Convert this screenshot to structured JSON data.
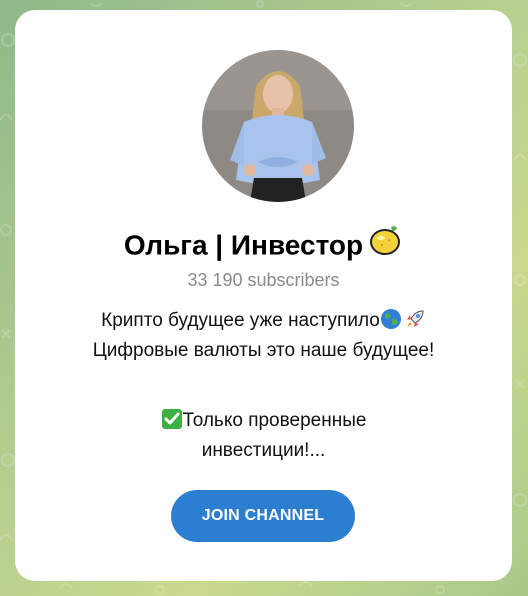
{
  "channel": {
    "name": "Ольга | Инвестор",
    "subscribers": "33 190 subscribers",
    "description": {
      "line1": "Крипто будущее уже наступило",
      "line2": "Цифровые валюты это наше будущее!",
      "line3": "Только проверенные",
      "line4": "инвестиции!..."
    }
  },
  "actions": {
    "join_label": "JOIN CHANNEL"
  },
  "icons": [
    "lemon-icon",
    "globe-icon",
    "rocket-icon",
    "check-mark-icon"
  ],
  "colors": {
    "accent": "#2c7fd0",
    "subscribers_text": "#8a8a8a",
    "card": "#ffffff"
  }
}
